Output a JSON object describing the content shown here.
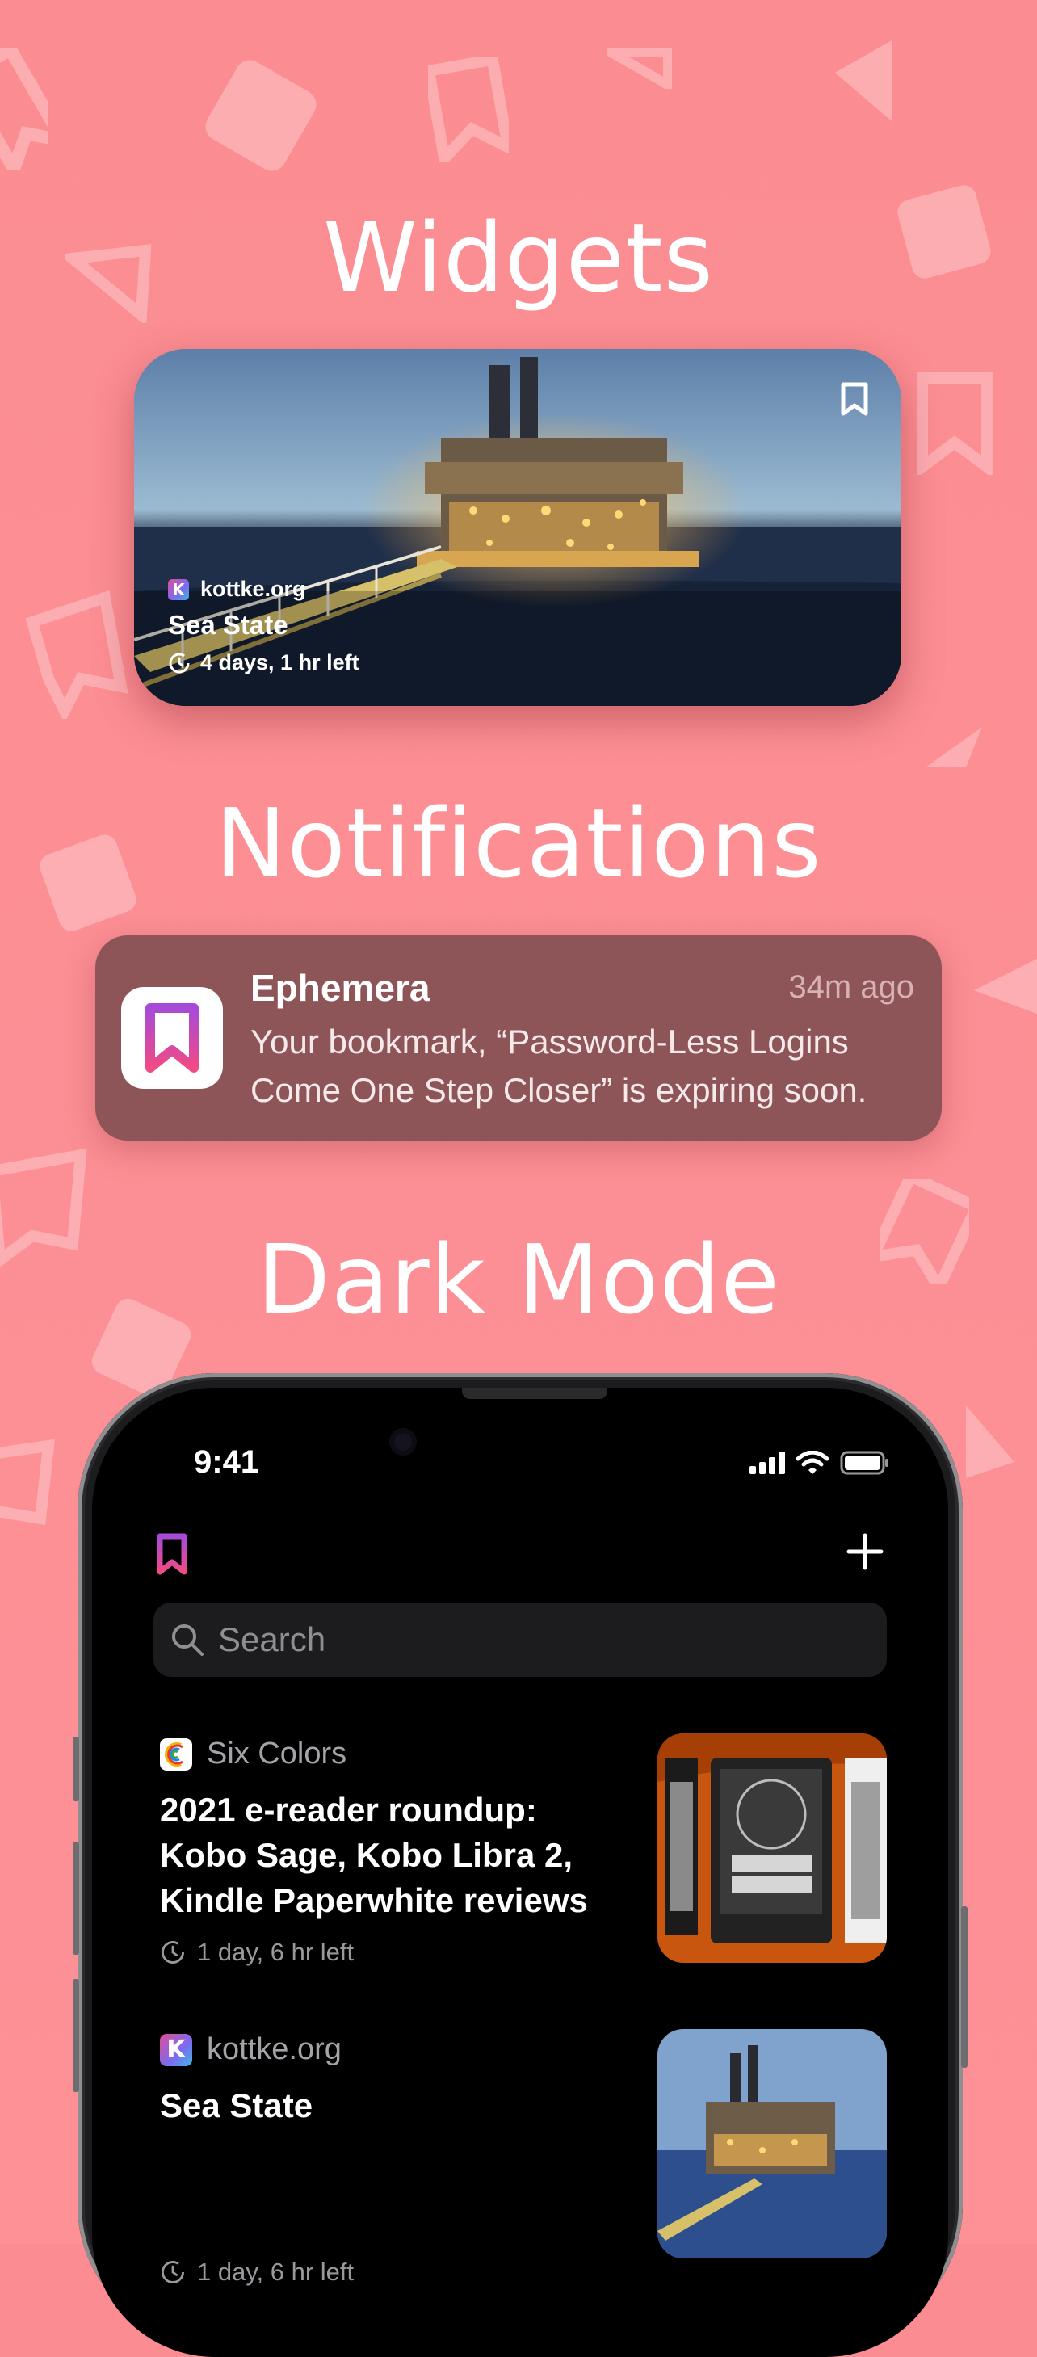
{
  "sections": {
    "widgets": "Widgets",
    "notifications": "Notifications",
    "dark_mode": "Dark Mode"
  },
  "widget": {
    "source": "kottke.org",
    "title": "Sea State",
    "time_left": "4 days, 1 hr left",
    "bookmark_icon": "bookmark-icon",
    "clock_icon": "clock-icon"
  },
  "notification": {
    "app_name": "Ephemera",
    "time": "34m ago",
    "body": "Your bookmark, “Password-Less Logins Come One Step Closer” is expiring soon."
  },
  "phone": {
    "status_time": "9:41",
    "search_placeholder": "Search",
    "articles": [
      {
        "source": "Six Colors",
        "title": "2021 e-reader roundup: Kobo Sage, Kobo Libra 2, Kindle Paperwhite reviews",
        "time_left": "1 day, 6 hr left"
      },
      {
        "source": "kottke.org",
        "title": "Sea State",
        "time_left": "1 day, 6 hr left"
      }
    ]
  },
  "colors": {
    "background": "#fc8f95",
    "notification_bg": "#8e5558",
    "brand_gradient_start": "#e24b9a",
    "brand_gradient_end": "#7a6cf0"
  }
}
